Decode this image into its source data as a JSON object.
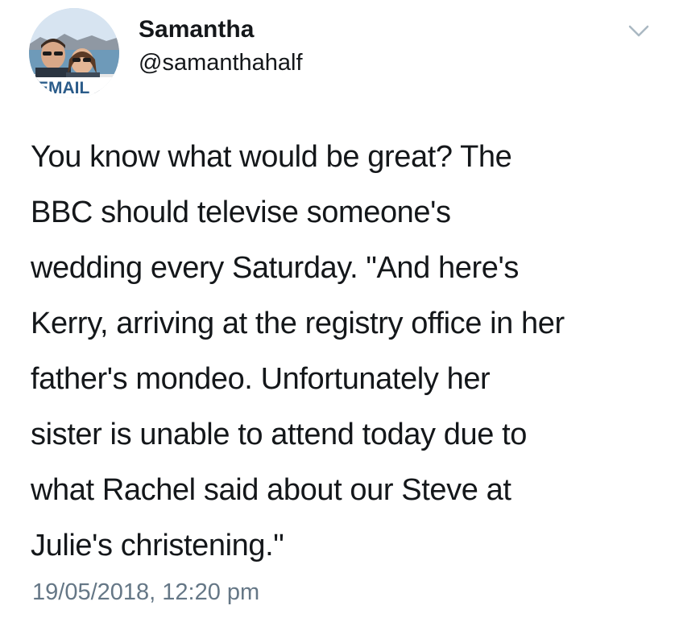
{
  "user": {
    "display_name": "Samantha",
    "handle": "@samanthahalf",
    "avatar_caption": "EMAIL"
  },
  "header": {
    "menu_icon": "chevron-down-icon"
  },
  "tweet": {
    "text": "You know what would be great? The\nBBC should televise someone's\nwedding every Saturday. \"And here's\nKerry, arriving at the registry office in her\nfather's mondeo. Unfortunately her\nsister is unable to attend today due to\nwhat Rachel said about our Steve at\nJulie's christening.\"",
    "timestamp": "19/05/2018, 12:20 pm"
  },
  "colors": {
    "text": "#14171a",
    "secondary_text": "#657786",
    "chevron": "#aab8c2",
    "background": "#ffffff"
  }
}
